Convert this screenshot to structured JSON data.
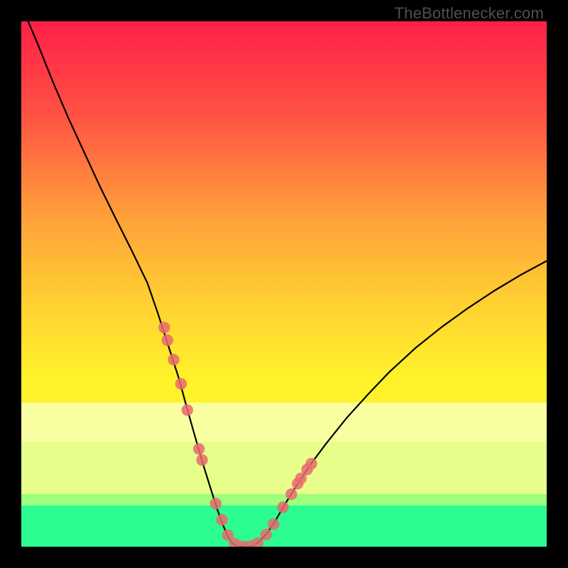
{
  "watermark": "TheBottlenecker.com",
  "chart_data": {
    "type": "line",
    "title": "",
    "xlabel": "",
    "ylabel": "",
    "xlim": [
      0,
      100
    ],
    "ylim": [
      0,
      100
    ],
    "gradient": {
      "stops": [
        {
          "pct": 0,
          "color": "#ff1f49"
        },
        {
          "pct": 18,
          "color": "#ff5343"
        },
        {
          "pct": 38,
          "color": "#ffa33a"
        },
        {
          "pct": 55,
          "color": "#ffd431"
        },
        {
          "pct": 68,
          "color": "#fff22a"
        },
        {
          "pct": 100,
          "color": "#fff22a"
        }
      ]
    },
    "bands": [
      {
        "top_pct": 72.5,
        "height_pct": 7.5,
        "color": "#f9ffa0"
      },
      {
        "top_pct": 80.0,
        "height_pct": 10.0,
        "color": "#e7ff8a"
      },
      {
        "top_pct": 90.0,
        "height_pct": 2.2,
        "color": "#9cff7d"
      },
      {
        "top_pct": 92.2,
        "height_pct": 7.8,
        "color": "#2dfd90"
      }
    ],
    "series": [
      {
        "name": "bottleneck-curve",
        "x": [
          0,
          3,
          6,
          9,
          12,
          15,
          18,
          21,
          24,
          26,
          28,
          30,
          31.5,
          33,
          34.5,
          36,
          37.3,
          38.4,
          39.3,
          40,
          41,
          42,
          43,
          44,
          45.2,
          46.8,
          48.4,
          50,
          52,
          55,
          58,
          62,
          66,
          70,
          75,
          80,
          85,
          90,
          95,
          100
        ],
        "y": [
          103,
          96,
          88.5,
          81.5,
          75,
          68.5,
          62.4,
          56.4,
          50.2,
          44.4,
          38.2,
          32,
          26.5,
          21.2,
          16,
          11.2,
          7.1,
          4.1,
          2,
          0.8,
          0.1,
          0.05,
          0.05,
          0.1,
          0.9,
          2.6,
          5,
          7.8,
          11,
          15.6,
          19.6,
          24.6,
          29,
          33.2,
          37.8,
          41.8,
          45.4,
          48.7,
          51.7,
          54.4
        ]
      }
    ],
    "markers": {
      "name": "data-points",
      "x": [
        27.2,
        27.8,
        29,
        30.4,
        31.6,
        33.8,
        34.4,
        37,
        38.2,
        39.3,
        40.6,
        42.2,
        43.6,
        45,
        46.6,
        48,
        49.8,
        51.4,
        52.6,
        53.2,
        54.4,
        55.2
      ],
      "y": [
        41.7,
        39.3,
        35.6,
        31,
        26,
        18.6,
        16.5,
        8.2,
        5.1,
        2.2,
        0.6,
        0.05,
        0.08,
        0.7,
        2.3,
        4.3,
        7.5,
        10,
        12,
        13,
        14.7,
        15.8
      ],
      "r": 8.2
    }
  }
}
